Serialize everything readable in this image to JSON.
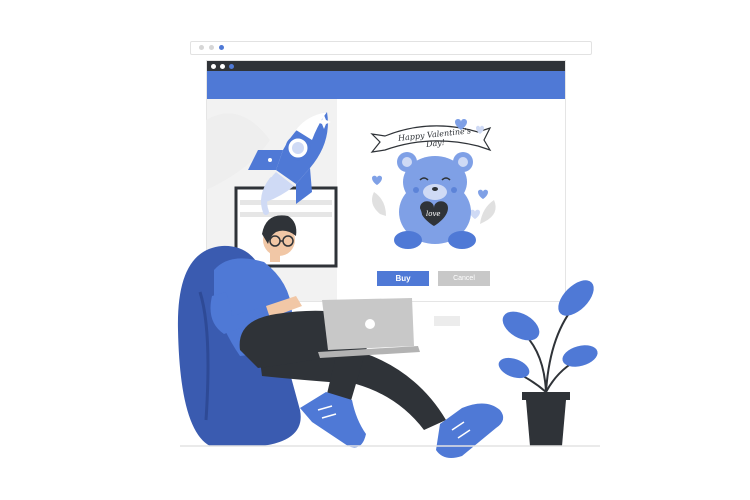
{
  "card": {
    "banner_text": "Happy Valentine's Day!",
    "bear_heart_text": "love"
  },
  "actions": {
    "buy_label": "Buy",
    "cancel_label": "Cancel"
  },
  "colors": {
    "accent": "#4f79d6",
    "dark": "#2f3338",
    "light_gray": "#c8c8c8",
    "background": "#ffffff"
  },
  "icons": [
    "rocket-icon",
    "teddy-bear-icon",
    "heart-icon",
    "laptop-icon",
    "plant-icon"
  ]
}
